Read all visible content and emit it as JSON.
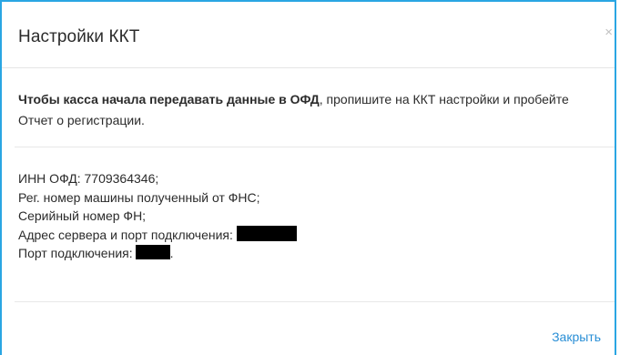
{
  "dialog": {
    "title": "Настройки ККТ",
    "close_glyph": "×",
    "intro_bold": "Чтобы касса начала передавать данные в ОФД",
    "intro_rest": ", пропишите на ККТ настройки и пробейте Отчет о регистрации.",
    "lines": {
      "inn": "ИНН ОФД: 7709364346;",
      "reg_number": "Рег. номер машины полученный от ФНС;",
      "serial": "Серийный номер ФН;",
      "server_label": "Адрес сервера и порт подключения:",
      "port_label": "Порт подключения:",
      "port_suffix": "."
    },
    "close_button_label": "Закрыть"
  },
  "colors": {
    "border": "#2aa6e3",
    "link": "#2a8fd6",
    "redaction": "#000000"
  },
  "icons": {
    "close": "close-icon"
  }
}
